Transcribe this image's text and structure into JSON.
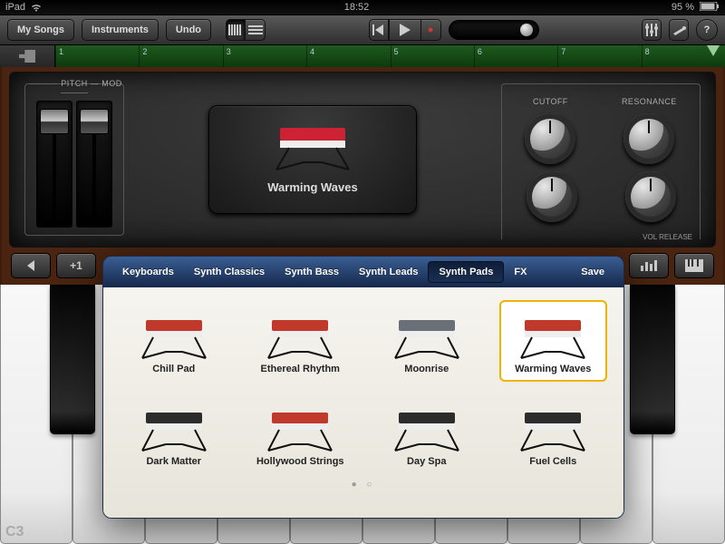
{
  "status": {
    "carrier": "iPad",
    "time": "18:52",
    "battery": "95 %"
  },
  "toolbar": {
    "my_songs": "My Songs",
    "instruments": "Instruments",
    "undo": "Undo"
  },
  "ruler": {
    "bars": [
      1,
      2,
      3,
      4,
      5,
      6,
      7,
      8
    ]
  },
  "panel": {
    "pitch": "PITCH",
    "mod": "MOD",
    "preset_name": "Warming Waves",
    "knobs": {
      "cutoff": "CUTOFF",
      "resonance": "RESONANCE",
      "vol_release": "VOL RELEASE"
    }
  },
  "octave_plus": "+1",
  "keyboard": {
    "label": "C3"
  },
  "popover": {
    "tabs": [
      "Keyboards",
      "Synth Classics",
      "Synth Bass",
      "Synth Leads",
      "Synth Pads",
      "FX"
    ],
    "selected_tab": 4,
    "save": "Save",
    "presets": [
      {
        "name": "Chill Pad",
        "color": "#c0392b"
      },
      {
        "name": "Ethereal Rhythm",
        "color": "#c0392b"
      },
      {
        "name": "Moonrise",
        "color": "#6b6f78"
      },
      {
        "name": "Warming Waves",
        "color": "#c0392b"
      },
      {
        "name": "Dark Matter",
        "color": "#2c2c2c"
      },
      {
        "name": "Hollywood Strings",
        "color": "#c0392b"
      },
      {
        "name": "Day Spa",
        "color": "#2c2c2c"
      },
      {
        "name": "Fuel Cells",
        "color": "#2c2c2c"
      }
    ],
    "selected_preset": 3
  }
}
